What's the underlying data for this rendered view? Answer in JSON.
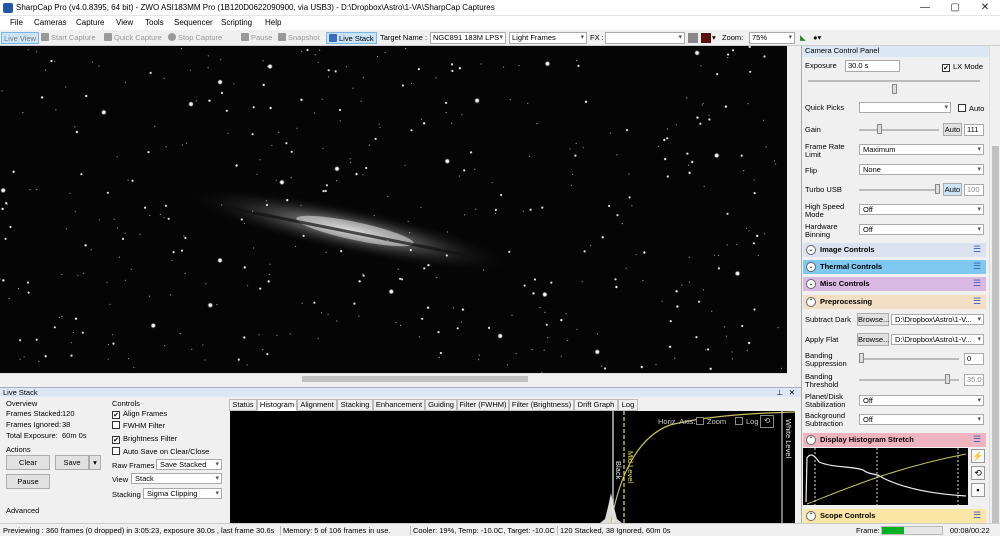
{
  "window": {
    "title": "SharpCap Pro (v4.0.8395, 64 bit) - ZWO ASI183MM Pro (1B120D0622090900, via USB3) - D:\\Dropbox\\Astro\\1-VA\\SharpCap Captures",
    "minimize": "—",
    "maximize": "▢",
    "close": "✕"
  },
  "menu": [
    "File",
    "Cameras",
    "Capture",
    "View",
    "Tools",
    "Sequencer",
    "Scripting",
    "Help"
  ],
  "toolbar": {
    "live_view": "Live View",
    "start_capture": "Start Capture",
    "quick_capture": "Quick Capture",
    "stop_capture": "Stop Capture",
    "pause": "Pause",
    "snapshot": "Snapshot",
    "live_stack": "Live Stack",
    "target_label": "Target Name :",
    "target_value": "NGC891 183M LPS",
    "frame_type": "Light Frames",
    "fx_label": "FX :",
    "fx_value": "",
    "zoom_label": "Zoom:",
    "zoom_value": "75%"
  },
  "live_stack": {
    "header": "Live Stack",
    "pin": "⊥",
    "close": "✕",
    "overview_label": "Overview",
    "frames_stacked_label": "Frames Stacked:",
    "frames_stacked": "120",
    "frames_ignored_label": "Frames Ignored:",
    "frames_ignored": "38",
    "total_exposure_label": "Total Exposure:",
    "total_exposure": "60m 0s",
    "actions_label": "Actions",
    "clear": "Clear",
    "save": "Save",
    "pause": "Pause",
    "advanced_label": "Advanced",
    "controls_label": "Controls",
    "align_frames": "Align Frames",
    "align_frames_checked": true,
    "fwhm_filter": "FWHM Filter",
    "fwhm_filter_checked": false,
    "brightness_filter": "Brightness Filter",
    "brightness_filter_checked": true,
    "auto_save": "Auto Save on Clear/Close",
    "auto_save_checked": false,
    "raw_frames_label": "Raw Frames",
    "raw_frames_value": "Save Stacked",
    "view_label": "View",
    "view_value": "Stack",
    "stacking_label": "Stacking",
    "stacking_value": "Sigma Clipping",
    "tabs": [
      "Status",
      "Histogram",
      "Alignment",
      "Stacking",
      "Enhancement",
      "Guiding",
      "Filter (FWHM)",
      "Filter (Brightness)",
      "Drift Graph",
      "Log"
    ],
    "selected_tab": "Histogram",
    "histogram": {
      "horiz_axis": "Horiz. Axis:",
      "zoom": "Zoom",
      "log": "Log",
      "black_level": "Black Level",
      "mid_level": "Mid Level",
      "white_level": "White Level",
      "black": "Black"
    }
  },
  "status_bar": {
    "previewing": "Previewing : 360 frames (0 dropped) in 3:05:23, exposure 30.0s , last frame 30.6s",
    "memory": "Memory: 5 of 106 frames in use.",
    "cooler": "Cooler: 19%, Temp: -10.0C, Target: -10.0C",
    "stack": "120 Stacked, 38 Ignored, 60m 0s",
    "frame_label": "Frame:",
    "frame_time": "00:08/00:22",
    "frame_progress": 0.36
  },
  "camera_panel": {
    "header": "Camera Control Panel",
    "exposure_label": "Exposure",
    "exposure_value": "30.0 s",
    "lx_mode": "LX Mode",
    "lx_mode_checked": true,
    "quick_picks_label": "Quick Picks",
    "auto_label": "Auto",
    "gain_label": "Gain",
    "gain_auto": "Auto",
    "gain_value": "111",
    "frame_rate_label": "Frame Rate Limit",
    "frame_rate_value": "Maximum",
    "flip_label": "Flip",
    "flip_value": "None",
    "turbo_label": "Turbo USB",
    "turbo_auto": "Auto",
    "turbo_value": "100",
    "high_speed_label": "High Speed Mode",
    "high_speed_value": "Off",
    "hw_binning_label": "Hardware Binning",
    "hw_binning_value": "Off",
    "image_controls": "Image Controls",
    "thermal_controls": "Thermal Controls",
    "misc_controls": "Misc Controls",
    "preprocessing": "Preprocessing",
    "subtract_dark_label": "Subtract Dark",
    "browse": "Browse...",
    "subtract_dark_path": "D:\\Dropbox\\Astro\\1-V...",
    "apply_flat_label": "Apply Flat",
    "apply_flat_path": "D:\\Dropbox\\Astro\\1-V...",
    "banding_supp_label": "Banding Suppression",
    "banding_supp_value": "0",
    "banding_thresh_label": "Banding Threshold",
    "banding_thresh_value": "35.0",
    "planet_disk_label": "Planet/Disk Stabilization",
    "planet_disk_value": "Off",
    "bg_sub_label": "Background Subtraction",
    "bg_sub_value": "Off",
    "display_histogram": "Display Histogram Stretch",
    "scope_controls": "Scope Controls",
    "colors": {
      "image_controls": "#dbe3f0",
      "thermal_controls": "#7fc8f0",
      "misc_controls": "#d9b9e3",
      "preprocessing": "#f3e0c4",
      "display_histogram": "#f0b3c0",
      "scope_controls": "#fbe6a6"
    }
  }
}
